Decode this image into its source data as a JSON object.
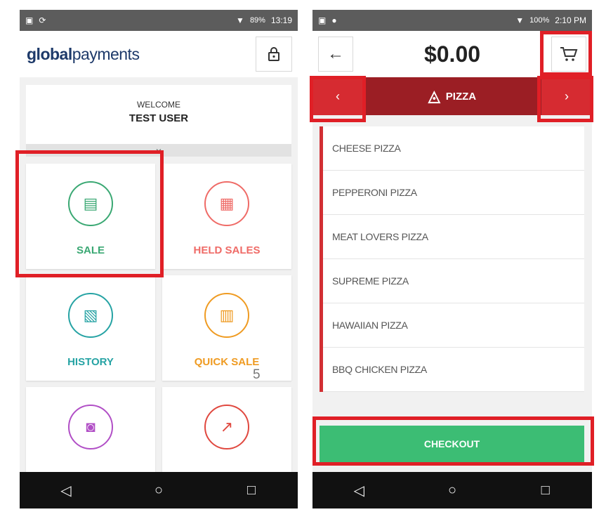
{
  "left": {
    "status": {
      "time": "13:19",
      "battery": "89%"
    },
    "logo": {
      "bold": "global",
      "light": "payments"
    },
    "welcome": {
      "line1": "WELCOME",
      "line2": "TEST USER"
    },
    "tiles": [
      {
        "label": "SALE",
        "color": "#3aa873",
        "icon": "sale-receipt-icon"
      },
      {
        "label": "HELD SALES",
        "color": "#ef6b67",
        "icon": "held-sales-icon"
      },
      {
        "label": "HISTORY",
        "color": "#26a3a4",
        "icon": "history-icon"
      },
      {
        "label": "QUICK SALE",
        "color": "#ef9b22",
        "icon": "quick-sale-icon"
      },
      {
        "label": "",
        "color": "#b14fc6",
        "icon": "management-safe-icon"
      },
      {
        "label": "",
        "color": "#e0483f",
        "icon": "reporting-chart-icon"
      }
    ]
  },
  "right": {
    "status": {
      "time": "2:10 PM",
      "battery": "100%"
    },
    "total": "$0.00",
    "category": "PIZZA",
    "items": [
      "CHEESE PIZZA",
      "PEPPERONI PIZZA",
      "MEAT LOVERS PIZZA",
      "SUPREME PIZZA",
      "HAWAIIAN PIZZA",
      "BBQ CHICKEN PIZZA"
    ],
    "checkout": "CHECKOUT"
  },
  "page_number": "5",
  "colors": {
    "highlight": "#e01f26",
    "checkout": "#3cbd74",
    "category_bar": "#9b1e24"
  }
}
